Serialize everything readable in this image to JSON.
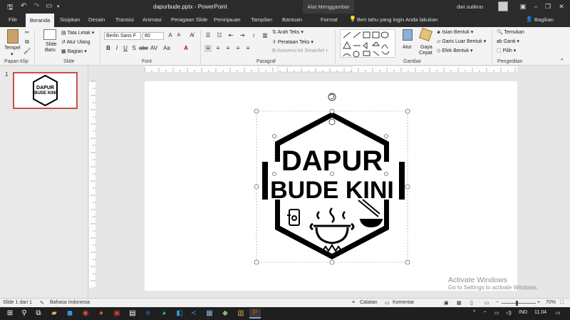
{
  "window": {
    "doc_title": "dapurbude.pptx  -  PowerPoint",
    "context_tab": "Alat Menggambar",
    "user": "dwi sutikno"
  },
  "tabs": [
    "File",
    "Beranda",
    "Sisipkan",
    "Desain",
    "Transisi",
    "Animasi",
    "Peragaan Slide",
    "Peninjauan",
    "Tampilan",
    "Bantuan",
    "Format"
  ],
  "tell_me": "Beri tahu yang ingin Anda lakukan",
  "share": "Bagikan",
  "ribbon": {
    "clipboard": {
      "paste": "Tempel",
      "label": "Papan Klip"
    },
    "slides": {
      "new_slide_1": "Slide",
      "new_slide_2": "Baru",
      "layout": "Tata Letak",
      "reset": "Atur Ulang",
      "section": "Bagian",
      "label": "Slide"
    },
    "font": {
      "name": "Berlin Sans F",
      "size": "80",
      "label": "Font"
    },
    "paragraph": {
      "text_direction": "Arah Teks",
      "align_text": "Perataan Teks",
      "smartart": "Konversi ke SmartArt",
      "label": "Paragraf"
    },
    "drawing": {
      "arrange": "Atur",
      "quick_styles_1": "Gaya",
      "quick_styles_2": "Cepat",
      "fill": "Isian Bentuk",
      "outline": "Garis Luar Bentuk",
      "effects": "Efek Bentuk",
      "label": "Gambar"
    },
    "editing": {
      "find": "Temukan",
      "replace": "Ganti",
      "select": "Pilih",
      "label": "Pengeditan"
    }
  },
  "thumbnail": {
    "number": "1"
  },
  "logo": {
    "line1": "DAPUR",
    "line2": "BUDE KINI",
    "border_color": "#000000"
  },
  "watermark": {
    "line1": "Activate Windows",
    "line2": "Go to Settings to activate Windows."
  },
  "status": {
    "slide_info": "Slide 1 dari 1",
    "language": "Bahasa Indonesia",
    "notes": "Catatan",
    "comments": "Komentar",
    "zoom": "70%"
  },
  "taskbar": {
    "lang": "IND",
    "time": "11.04"
  },
  "colors": {
    "accent": "#c43e1c",
    "dark": "#2b2b2b",
    "ribbon": "#f3f3f3"
  }
}
